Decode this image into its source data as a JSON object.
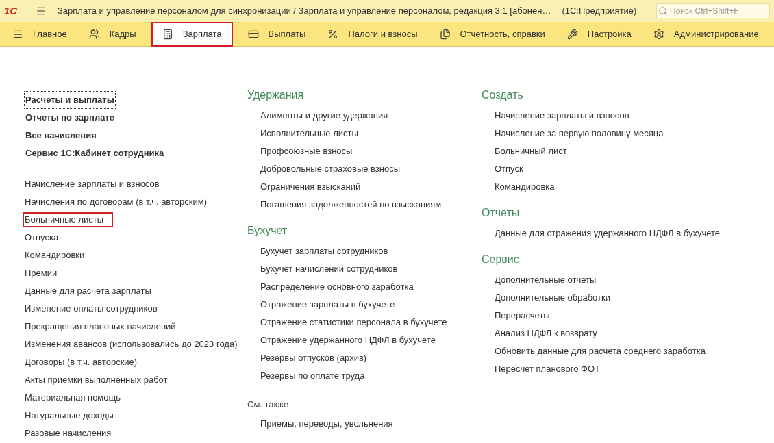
{
  "title_bar": {
    "logo": "1С",
    "title": "Зарплата и управление персоналом для синхронизации / Зарплата и управление персоналом, редакция 3.1 [абонен…",
    "platform": "(1С:Предприятие)",
    "search": {
      "placeholder": "Поиск Ctrl+Shift+F"
    }
  },
  "sections": [
    {
      "kind": "home",
      "label": "Главное",
      "highlighted": false
    },
    {
      "kind": "people",
      "label": "Кадры",
      "highlighted": false
    },
    {
      "kind": "calculator",
      "label": "Зарплата",
      "highlighted": true
    },
    {
      "kind": "card",
      "label": "Выплаты",
      "highlighted": false
    },
    {
      "kind": "percent",
      "label": "Налоги и взносы",
      "highlighted": false
    },
    {
      "kind": "reports",
      "label": "Отчетность, справки",
      "highlighted": false
    },
    {
      "kind": "wrench",
      "label": "Настройка",
      "highlighted": false
    },
    {
      "kind": "gear",
      "label": "Администрирование",
      "highlighted": false
    }
  ],
  "left_column": {
    "main_links": [
      {
        "label": "Расчеты и выплаты",
        "focused": true
      },
      {
        "label": "Отчеты по зарплате",
        "focused": false
      },
      {
        "label": "Все начисления",
        "focused": false
      },
      {
        "label": "Сервис 1С:Кабинет сотрудника",
        "focused": false
      }
    ],
    "links": [
      {
        "label": "Начисление зарплаты и взносов",
        "highlighted": false
      },
      {
        "label": "Начисления по договорам (в т.ч. авторским)",
        "highlighted": false
      },
      {
        "label": "Больничные листы",
        "highlighted": true
      },
      {
        "label": "Отпуска",
        "highlighted": false
      },
      {
        "label": "Командировки",
        "highlighted": false
      },
      {
        "label": "Премии",
        "highlighted": false
      },
      {
        "label": "Данные для расчета зарплаты",
        "highlighted": false
      },
      {
        "label": "Изменение оплаты сотрудников",
        "highlighted": false
      },
      {
        "label": "Прекращения плановых начислений",
        "highlighted": false
      },
      {
        "label": "Изменения авансов (использовались до 2023 года)",
        "highlighted": false
      },
      {
        "label": "Договоры (в т.ч. авторские)",
        "highlighted": false
      },
      {
        "label": "Акты приемки выполненных работ",
        "highlighted": false
      },
      {
        "label": "Материальная помощь",
        "highlighted": false
      },
      {
        "label": "Натуральные доходы",
        "highlighted": false
      },
      {
        "label": "Разовые начисления",
        "highlighted": false
      }
    ]
  },
  "middle_column": {
    "groups": [
      {
        "title": "Удержания",
        "links": [
          "Алименты и другие удержания",
          "Исполнительные листы",
          "Профсоюзные взносы",
          "Добровольные страховые взносы",
          "Ограничения взысканий",
          "Погашения задолженностей по взысканиям"
        ]
      },
      {
        "title": "Бухучет",
        "links": [
          "Бухучет зарплаты сотрудников",
          "Бухучет начислений сотрудников",
          "Распределение основного заработка",
          "Отражение зарплаты в бухучете",
          "Отражение статистики персонала в бухучете",
          "Отражение удержанного НДФЛ в бухучете",
          "Резервы отпусков (архив)",
          "Резервы по оплате труда"
        ]
      }
    ],
    "see_also": {
      "title": "См. также",
      "links": [
        "Приемы, переводы, увольнения"
      ]
    }
  },
  "right_column": {
    "groups": [
      {
        "title": "Создать",
        "links": [
          "Начисление зарплаты и взносов",
          "Начисление за первую половину месяца",
          "Больничный лист",
          "Отпуск",
          "Командировка"
        ]
      },
      {
        "title": "Отчеты",
        "links": [
          "Данные для отражения удержанного НДФЛ в бухучете"
        ]
      },
      {
        "title": "Сервис",
        "links": [
          "Дополнительные отчеты",
          "Дополнительные обработки",
          "Перерасчеты",
          "Анализ НДФЛ к возврату",
          "Обновить данные для расчета среднего заработка",
          "Пересчет планового ФОТ"
        ]
      }
    ]
  }
}
